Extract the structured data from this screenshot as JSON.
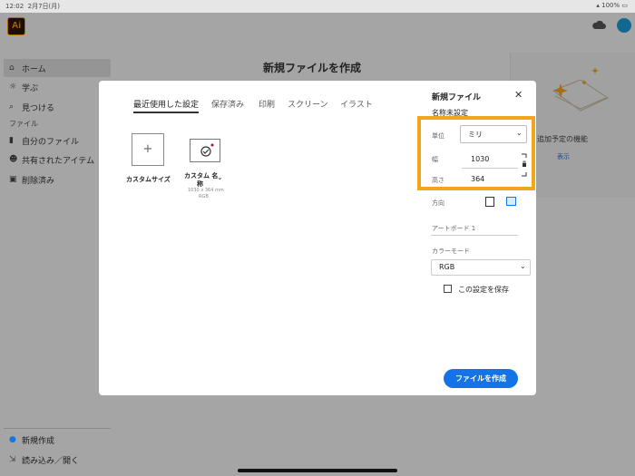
{
  "status_bar": {
    "time": "12:02",
    "date": "2月7日(月)",
    "battery": "100%"
  },
  "app": {
    "logo_text": "Ai",
    "brand_color": "#ff9a00"
  },
  "sidebar": {
    "items": [
      {
        "label": "ホーム",
        "icon": "home-icon"
      },
      {
        "label": "学ぶ",
        "icon": "lightbulb-icon"
      },
      {
        "label": "見つける",
        "icon": "search-icon"
      }
    ],
    "section_label": "ファイル",
    "file_items": [
      {
        "label": "自分のファイル",
        "icon": "document-icon"
      },
      {
        "label": "共有されたアイテム",
        "icon": "people-icon"
      },
      {
        "label": "削除済み",
        "icon": "trash-icon"
      }
    ],
    "bottom_items": [
      {
        "label": "新規作成",
        "icon": "plus-circle-icon"
      },
      {
        "label": "読み込み／開く",
        "icon": "import-icon"
      }
    ]
  },
  "background": {
    "title": "新規ファイルを作成",
    "promo_title": "と追加予定の機能",
    "promo_link": "表示"
  },
  "dialog": {
    "tabs": [
      "最近使用した設定",
      "保存済み",
      "印刷",
      "スクリーン",
      "イラスト"
    ],
    "active_tab": 0,
    "presets": [
      {
        "label": "カスタムサイズ"
      },
      {
        "label_line1": "カスタム 名",
        "label_line2": "称",
        "size": "1030 x 364 mm",
        "mode": "RGB"
      }
    ],
    "panel": {
      "title": "新規ファイル",
      "name": "名称未設定",
      "unit_label": "単位",
      "unit_value": "ミリ",
      "width_label": "幅",
      "width_value": "1030",
      "height_label": "高さ",
      "height_value": "364",
      "orientation_label": "方向",
      "artboard_label": "アートボード 1",
      "color_mode_label": "カラーモード",
      "color_mode_value": "RGB",
      "save_setting_label": "この設定を保存",
      "save_setting_checked": false,
      "create_button": "ファイルを作成"
    },
    "accent_color": "#1473e6",
    "highlight_color": "#f2a61e"
  }
}
